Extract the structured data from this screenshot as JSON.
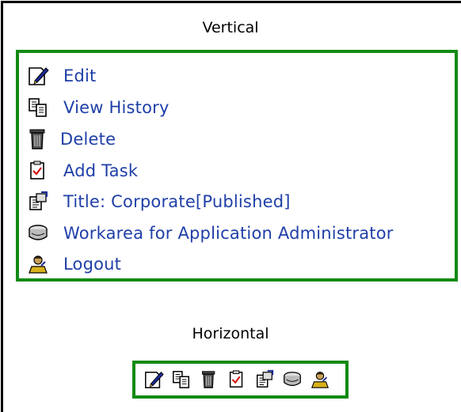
{
  "vertical_heading": "Vertical",
  "horizontal_heading": "Horizontal",
  "menu_items": [
    {
      "label": "Edit",
      "icon": "edit-icon"
    },
    {
      "label": "View History",
      "icon": "history-icon"
    },
    {
      "label": "Delete",
      "icon": "trash-icon"
    },
    {
      "label": "Add Task",
      "icon": "task-icon"
    },
    {
      "label": "Title: Corporate[Published]",
      "icon": "properties-icon"
    },
    {
      "label": "Workarea for Application Administrator",
      "icon": "workarea-icon"
    },
    {
      "label": "Logout",
      "icon": "logout-icon"
    }
  ],
  "colors": {
    "link": "#1f3fa8",
    "border": "#138a13"
  }
}
